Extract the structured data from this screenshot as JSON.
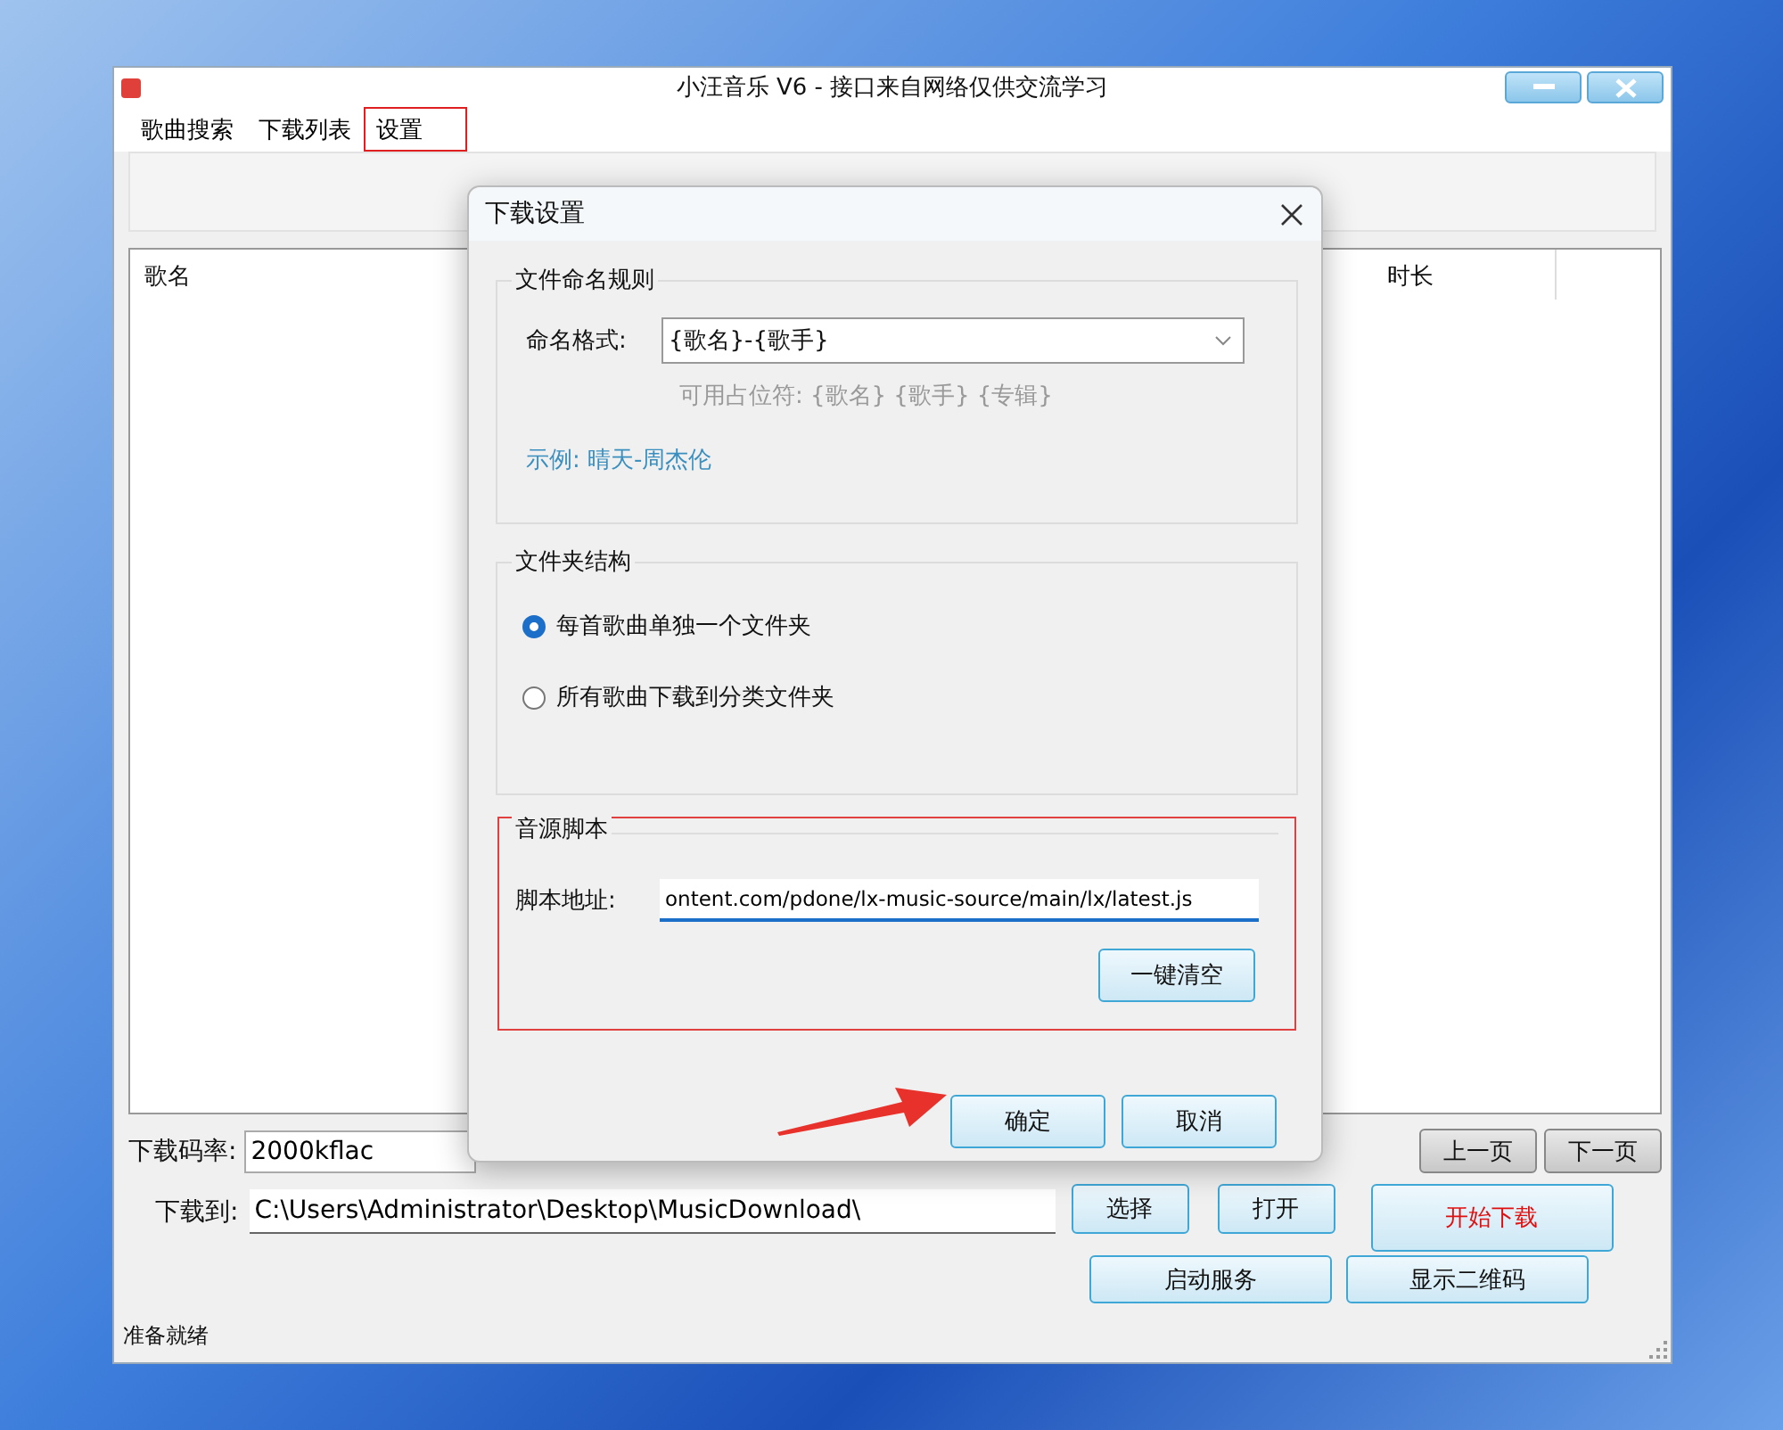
{
  "window": {
    "title": "小汪音乐 V6 - 接口来自网络仅供交流学习"
  },
  "tabs": [
    {
      "label": "歌曲搜索",
      "selected": false
    },
    {
      "label": "下载列表",
      "selected": false
    },
    {
      "label": "设置",
      "selected": true
    }
  ],
  "table": {
    "columns": [
      "歌名",
      "时长"
    ]
  },
  "bitrate": {
    "label": "下载码率:",
    "value": "2000kflac"
  },
  "pager": [
    "上一页",
    "下一页"
  ],
  "download_to": {
    "label": "下载到:",
    "value": "C:\\Users\\Administrator\\Desktop\\MusicDownload\\"
  },
  "path_buttons": [
    "选择",
    "打开"
  ],
  "start_button": "开始下载",
  "service_buttons": [
    "启动服务",
    "显示二维码"
  ],
  "status_bar": "准备就绪",
  "dialog": {
    "title": "下载设置",
    "naming": {
      "legend": "文件命名规则",
      "label": "命名格式:",
      "value": "{歌名}-{歌手}",
      "hint": "可用占位符: {歌名} {歌手} {专辑}",
      "example": "示例: 晴天-周杰伦"
    },
    "folder": {
      "legend": "文件夹结构",
      "options": [
        {
          "label": "每首歌曲单独一个文件夹",
          "selected": true
        },
        {
          "label": "所有歌曲下载到分类文件夹",
          "selected": false
        }
      ]
    },
    "script": {
      "legend": "音源脚本",
      "highlighted": true,
      "label": "脚本地址:",
      "value": "ontent.com/pdone/lx-music-source/main/lx/latest.js",
      "clear_button": "一键清空"
    },
    "buttons": [
      "确定",
      "取消"
    ]
  }
}
